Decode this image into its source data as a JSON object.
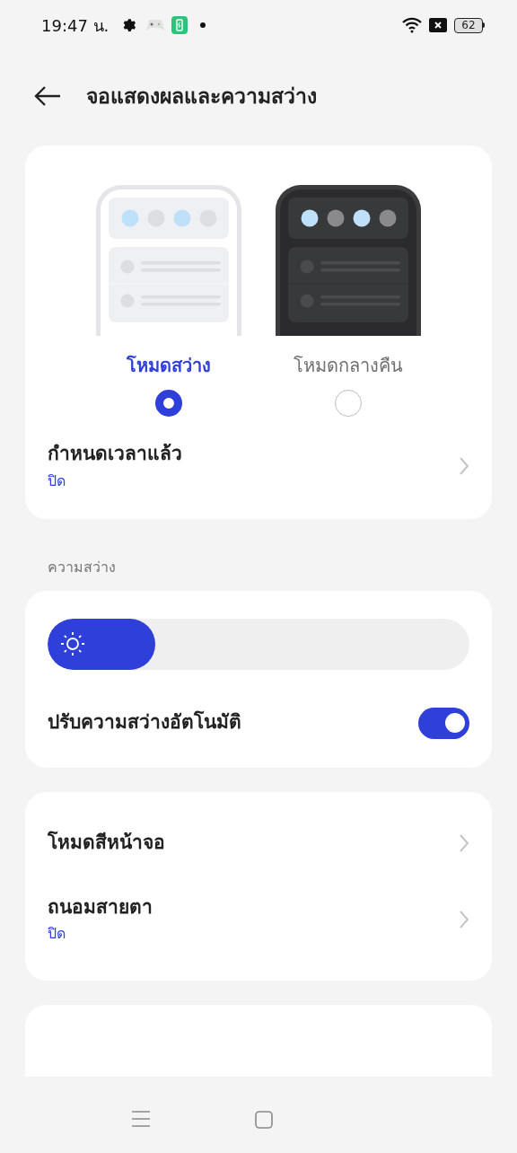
{
  "status_bar": {
    "time": "19:47 น.",
    "battery": "62"
  },
  "header": {
    "title": "จอแสดงผลและความสว่าง"
  },
  "theme_options": [
    {
      "kind": "light",
      "label": "โหมดสว่าง",
      "selected": true
    },
    {
      "kind": "dark",
      "label": "โหมดกลางคืน",
      "selected": false
    }
  ],
  "schedule": {
    "title": "กำหนดเวลาแล้ว",
    "value": "ปิด"
  },
  "brightness": {
    "section_label": "ความสว่าง",
    "level": 0.255,
    "auto_label": "ปรับความสว่างอัตโนมัติ",
    "auto_on": true
  },
  "display_items": [
    {
      "title": "โหมดสีหน้าจอ"
    },
    {
      "title": "ถนอมสายตา",
      "value": "ปิด"
    }
  ]
}
